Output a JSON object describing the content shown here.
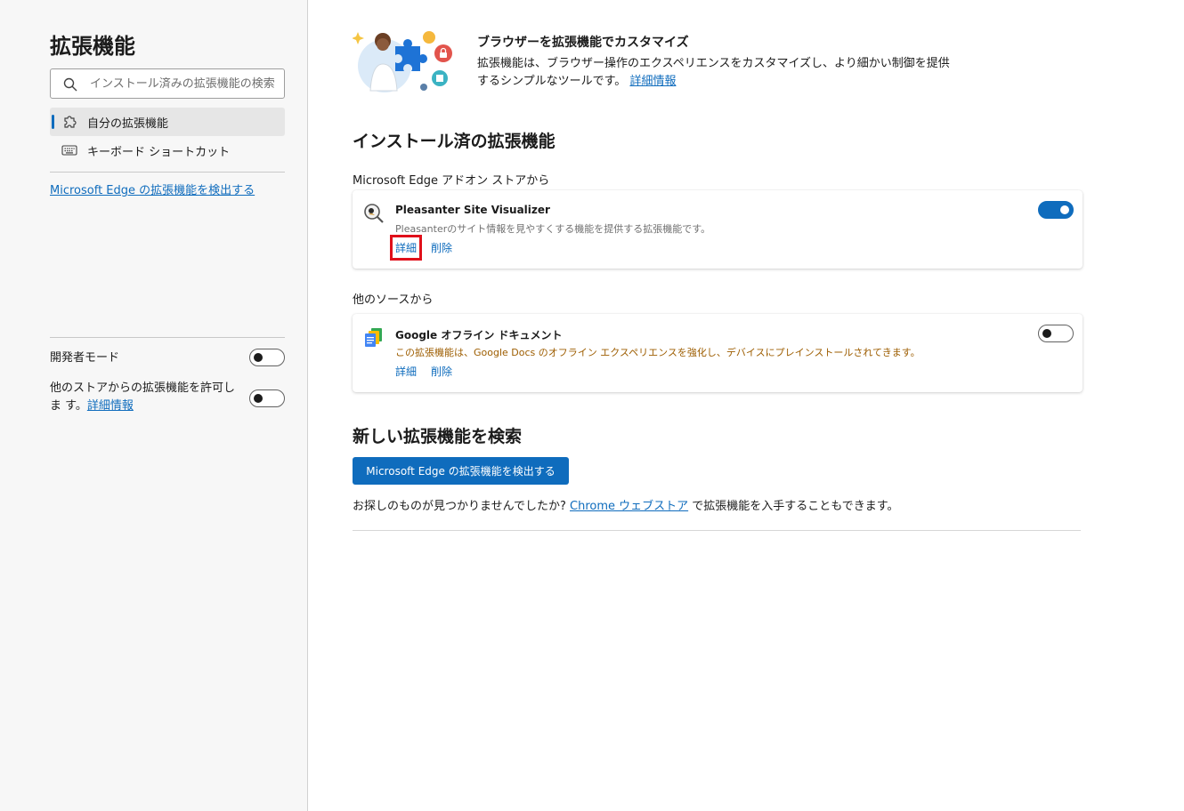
{
  "sidebar": {
    "title": "拡張機能",
    "search": {
      "placeholder": "インストール済みの拡張機能の検索"
    },
    "nav": [
      {
        "label": "自分の拡張機能",
        "icon": "puzzle-icon",
        "active": true
      },
      {
        "label": "キーボード ショートカット",
        "icon": "keyboard-icon",
        "active": false
      }
    ],
    "discover_link": "Microsoft Edge の拡張機能を検出する",
    "developer_mode": {
      "label": "開発者モード",
      "enabled": false
    },
    "allow_other_stores": {
      "label": "他のストアからの拡張機能を許可しま す。",
      "link": "詳細情報",
      "enabled": false
    }
  },
  "hero": {
    "title": "ブラウザーを拡張機能でカスタマイズ",
    "description": "拡張機能は、ブラウザー操作のエクスペリエンスをカスタマイズし、より細かい制御を提供するシンプルなツールです。",
    "link": "詳細情報"
  },
  "installed": {
    "title": "インストール済の拡張機能",
    "from_store_label": "Microsoft Edge アドオン ストアから",
    "from_other_label": "他のソースから",
    "store_extensions": [
      {
        "name": "Pleasanter Site Visualizer",
        "description": "Pleasanterのサイト情報を見やすくする機能を提供する拡張機能です。",
        "details_label": "詳細",
        "remove_label": "削除",
        "enabled": true
      }
    ],
    "other_extensions": [
      {
        "name": "Google オフライン ドキュメント",
        "description": "この拡張機能は、Google Docs のオフライン エクスペリエンスを強化し、デバイスにプレインストールされてきます。",
        "details_label": "詳細",
        "remove_label": "削除",
        "enabled": false
      }
    ]
  },
  "find_new": {
    "title": "新しい拡張機能を検索",
    "button_label": "Microsoft Edge の拡張機能を検出する",
    "text_before": "お探しのものが見つかりませんでしたか?",
    "chrome_link": "Chrome ウェブストア",
    "text_after": "で拡張機能を入手することもできます。"
  },
  "colors": {
    "accent": "#0f6cbd",
    "highlight_box": "#e0101a",
    "warning_text": "#9d5d00"
  }
}
